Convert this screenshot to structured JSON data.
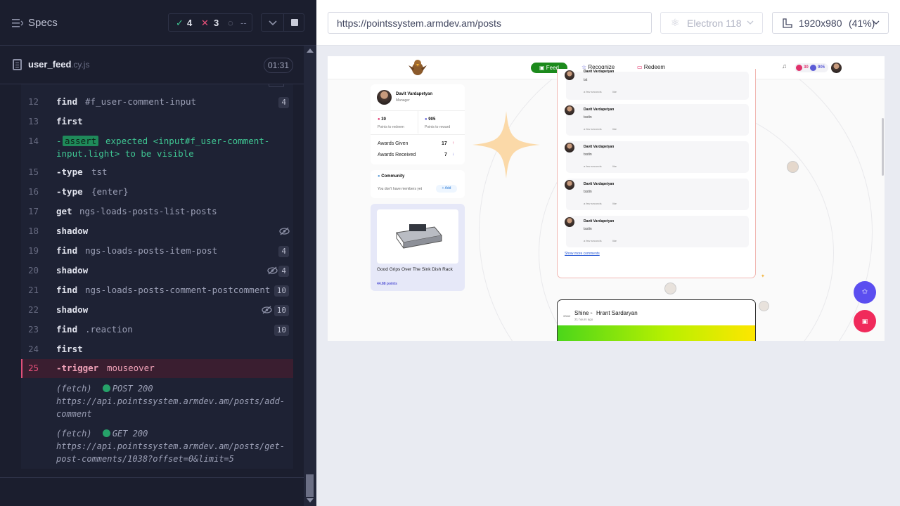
{
  "left": {
    "title": "Specs",
    "stats": {
      "passed": "4",
      "failed": "3",
      "pending": "--"
    },
    "spec": {
      "name": "user_feed",
      "ext": ".cy.js",
      "time": "01:31"
    },
    "commands": [
      {
        "n": "12",
        "name": "find",
        "msg": "#f_user-comment-input",
        "badge": "4"
      },
      {
        "n": "13",
        "name": "first",
        "msg": ""
      },
      {
        "n": "14",
        "assert_label": "assert",
        "assert_text": "expected <input#f_user-comment-",
        "assert_text2": "input.light> to be visible"
      },
      {
        "n": "15",
        "name": "-type",
        "msg": "tst"
      },
      {
        "n": "16",
        "name": "-type",
        "msg": "{enter}"
      },
      {
        "n": "17",
        "name": "get",
        "msg": "ngs-loads-posts-list-posts"
      },
      {
        "n": "18",
        "name": "shadow",
        "msg": ""
      },
      {
        "n": "19",
        "name": "find",
        "msg": "ngs-loads-posts-item-post",
        "badge": "4"
      },
      {
        "n": "20",
        "name": "shadow",
        "msg": "",
        "badge": "4"
      },
      {
        "n": "21",
        "name": "find",
        "msg": "ngs-loads-posts-comment-postcomment",
        "badge": "10"
      },
      {
        "n": "22",
        "name": "shadow",
        "msg": "",
        "badge": "10"
      },
      {
        "n": "23",
        "name": "find",
        "msg": ".reaction",
        "badge": "10"
      },
      {
        "n": "24",
        "name": "first",
        "msg": ""
      },
      {
        "n": "25",
        "name": "-trigger",
        "msg": "mouseover"
      }
    ],
    "fetches": [
      {
        "label": "(fetch)",
        "status": "POST 200",
        "url": "https://api.pointssystem.armdev.am/posts/add-comment"
      },
      {
        "label": "(fetch)",
        "status": "GET 200",
        "url": "https://api.pointssystem.armdev.am/posts/get-post-comments/1038?offset=0&limit=5"
      }
    ]
  },
  "right": {
    "url": "https://pointssystem.armdev.am/posts",
    "browser": "Electron 118",
    "viewport": "1920x980",
    "viewport_pct": "(41%)"
  },
  "app": {
    "nav": {
      "feed": "Feed",
      "recognize": "Recognize",
      "redeem": "Redeem",
      "points_a": "30",
      "points_b": "905"
    },
    "profile": {
      "name": "Davit Vardapetyan",
      "role": "Manager",
      "redeem_value": "30",
      "redeem_label": "Points to redeem",
      "reward_value": "905",
      "reward_label": "Points to reward",
      "given_label": "Awards Given",
      "given_value": "17",
      "received_label": "Awards Received",
      "received_value": "7"
    },
    "community": {
      "title": "Community",
      "text": "You don't have members yet",
      "add": "Add"
    },
    "product": {
      "title": "Good Grips Over The Sink Dish Rack",
      "points": "44.88 points"
    },
    "comments": [
      {
        "author": "Davit Vardapetyan",
        "text": "tst",
        "time": "a few seconds",
        "like": "like"
      },
      {
        "author": "Davit Vardapetyan",
        "text": "tsstin",
        "time": "a few seconds",
        "like": "like"
      },
      {
        "author": "Davit Vardapetyan",
        "text": "tsstin",
        "time": "a few seconds",
        "like": "like"
      },
      {
        "author": "Davit Vardapetyan",
        "text": "tsstin",
        "time": "a few seconds",
        "like": "like"
      },
      {
        "author": "Davit Vardapetyan",
        "text": "tsstin",
        "time": "a few seconds",
        "like": "like"
      }
    ],
    "show_more": "Show more comments",
    "post2": {
      "from": "Shine",
      "to": "Hrant Sardaryan",
      "time": "21 hours ago"
    }
  }
}
